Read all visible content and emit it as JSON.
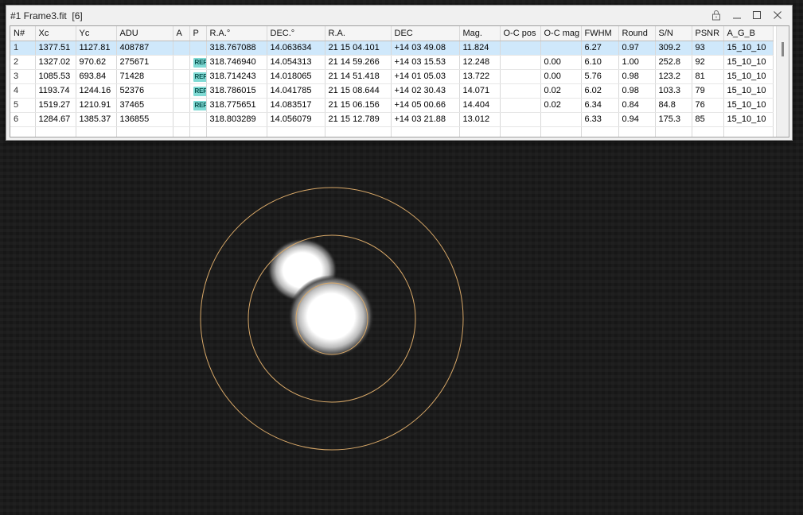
{
  "window": {
    "title": "#1 Frame3.fit  [6]"
  },
  "table": {
    "columns": [
      "N#",
      "Xc",
      "Yc",
      "ADU",
      "A",
      "P",
      "R.A.°",
      "DEC.°",
      "R.A.",
      "DEC",
      "Mag.",
      "O-C pos",
      "O-C mag",
      "FWHM",
      "Round",
      "S/N",
      "PSNR",
      "A_G_B"
    ],
    "rows": [
      {
        "n": "1",
        "xc": "1377.51",
        "yc": "1127.81",
        "adu": "408787",
        "a": "",
        "p": "",
        "ra_deg": "318.767088",
        "dec_deg": "14.063634",
        "ra": "21 15 04.101",
        "dec": "+14 03 49.08",
        "mag": "11.824",
        "oc_pos": "",
        "oc_mag": "",
        "fwhm": "6.27",
        "round": "0.97",
        "sn": "309.2",
        "psnr": "93",
        "agb": "15_10_10",
        "selected": true
      },
      {
        "n": "2",
        "xc": "1327.02",
        "yc": "970.62",
        "adu": "275671",
        "a": "",
        "p": "REF",
        "ra_deg": "318.746940",
        "dec_deg": "14.054313",
        "ra": "21 14 59.266",
        "dec": "+14 03 15.53",
        "mag": "12.248",
        "oc_pos": "",
        "oc_mag": "0.00",
        "fwhm": "6.10",
        "round": "1.00",
        "sn": "252.8",
        "psnr": "92",
        "agb": "15_10_10",
        "selected": false
      },
      {
        "n": "3",
        "xc": "1085.53",
        "yc": "693.84",
        "adu": "71428",
        "a": "",
        "p": "REF",
        "ra_deg": "318.714243",
        "dec_deg": "14.018065",
        "ra": "21 14 51.418",
        "dec": "+14 01 05.03",
        "mag": "13.722",
        "oc_pos": "",
        "oc_mag": "0.00",
        "fwhm": "5.76",
        "round": "0.98",
        "sn": "123.2",
        "psnr": "81",
        "agb": "15_10_10",
        "selected": false
      },
      {
        "n": "4",
        "xc": "1193.74",
        "yc": "1244.16",
        "adu": "52376",
        "a": "",
        "p": "REF",
        "ra_deg": "318.786015",
        "dec_deg": "14.041785",
        "ra": "21 15 08.644",
        "dec": "+14 02 30.43",
        "mag": "14.071",
        "oc_pos": "",
        "oc_mag": "0.02",
        "fwhm": "6.02",
        "round": "0.98",
        "sn": "103.3",
        "psnr": "79",
        "agb": "15_10_10",
        "selected": false
      },
      {
        "n": "5",
        "xc": "1519.27",
        "yc": "1210.91",
        "adu": "37465",
        "a": "",
        "p": "REF",
        "ra_deg": "318.775651",
        "dec_deg": "14.083517",
        "ra": "21 15 06.156",
        "dec": "+14 05 00.66",
        "mag": "14.404",
        "oc_pos": "",
        "oc_mag": "0.02",
        "fwhm": "6.34",
        "round": "0.84",
        "sn": "84.8",
        "psnr": "76",
        "agb": "15_10_10",
        "selected": false
      },
      {
        "n": "6",
        "xc": "1284.67",
        "yc": "1385.37",
        "adu": "136855",
        "a": "",
        "p": "",
        "ra_deg": "318.803289",
        "dec_deg": "14.056079",
        "ra": "21 15 12.789",
        "dec": "+14 03 21.88",
        "mag": "13.012",
        "oc_pos": "",
        "oc_mag": "",
        "fwhm": "6.33",
        "round": "0.94",
        "sn": "175.3",
        "psnr": "85",
        "agb": "15_10_10",
        "selected": false
      }
    ]
  },
  "colors": {
    "aperture_ring": "#d8a868",
    "ref_badge": "#7fdad4",
    "selected_row": "#cfe8fb"
  },
  "icons": {
    "lock": "lock-icon",
    "minimize": "minimize-icon",
    "maximize": "maximize-icon",
    "close": "close-icon"
  }
}
